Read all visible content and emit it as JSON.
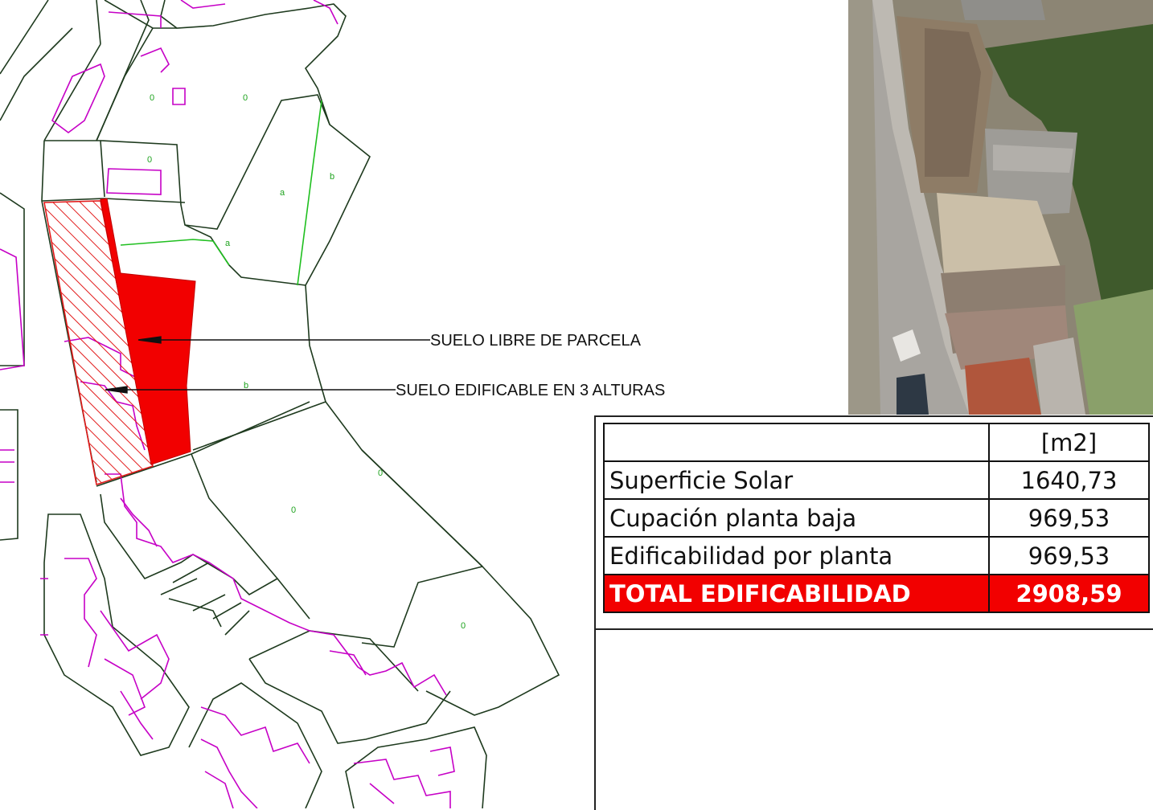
{
  "annotations": {
    "free_land": "SUELO LIBRE DE PARCELA",
    "buildable_land": "SUELO EDIFICABLE EN 3 ALTURAS"
  },
  "parcel_codes": {
    "p1": "0",
    "p2": "0",
    "p3": "0",
    "p4": "a",
    "p5": "b",
    "p6": "a",
    "p7": "b",
    "p8": "0",
    "p9": "0",
    "p10": "0"
  },
  "table": {
    "header": {
      "label": "",
      "unit": "[m2]"
    },
    "rows": [
      {
        "label": "Superficie Solar",
        "value": "1640,73"
      },
      {
        "label": "Cupación planta baja",
        "value": "969,53"
      },
      {
        "label": "Edificabilidad por planta",
        "value": "969,53"
      }
    ],
    "total": {
      "label": "TOTAL EDIFICABILIDAD",
      "value": "2908,59"
    }
  },
  "colors": {
    "buildable": "#f20000",
    "parcel_line": "#1e3a1e",
    "building_line": "#c600c6",
    "subparcel_line": "#1fbf1f"
  }
}
